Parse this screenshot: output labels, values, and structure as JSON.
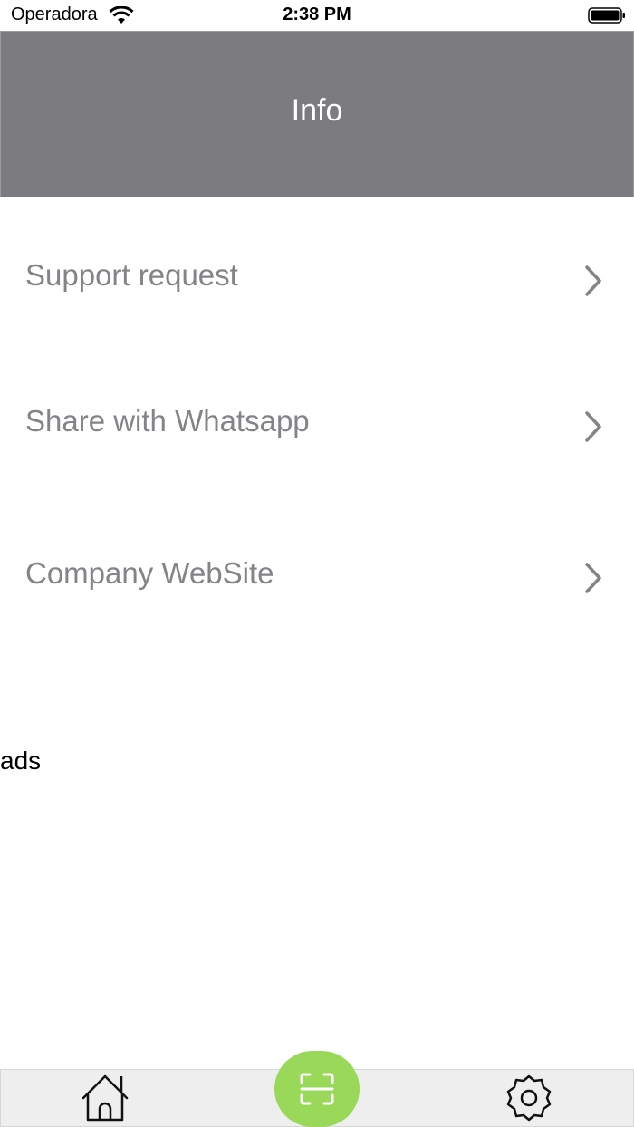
{
  "status_bar": {
    "carrier": "Operadora",
    "time": "2:38 PM"
  },
  "header": {
    "title": "Info"
  },
  "menu": {
    "items": [
      {
        "label": "Support request",
        "icon": "chevron-right-icon"
      },
      {
        "label": "Share with Whatsapp",
        "icon": "chevron-right-icon"
      },
      {
        "label": "Company WebSite",
        "icon": "chevron-right-icon"
      }
    ]
  },
  "ads": {
    "text": "ads"
  },
  "tab_bar": {
    "items": [
      {
        "name": "home",
        "icon": "home-icon"
      },
      {
        "name": "scan",
        "icon": "scan-icon"
      },
      {
        "name": "settings",
        "icon": "gear-icon"
      }
    ],
    "accent": "#99d858"
  },
  "colors": {
    "header_bg": "#7b7b80",
    "label": "#838388"
  }
}
